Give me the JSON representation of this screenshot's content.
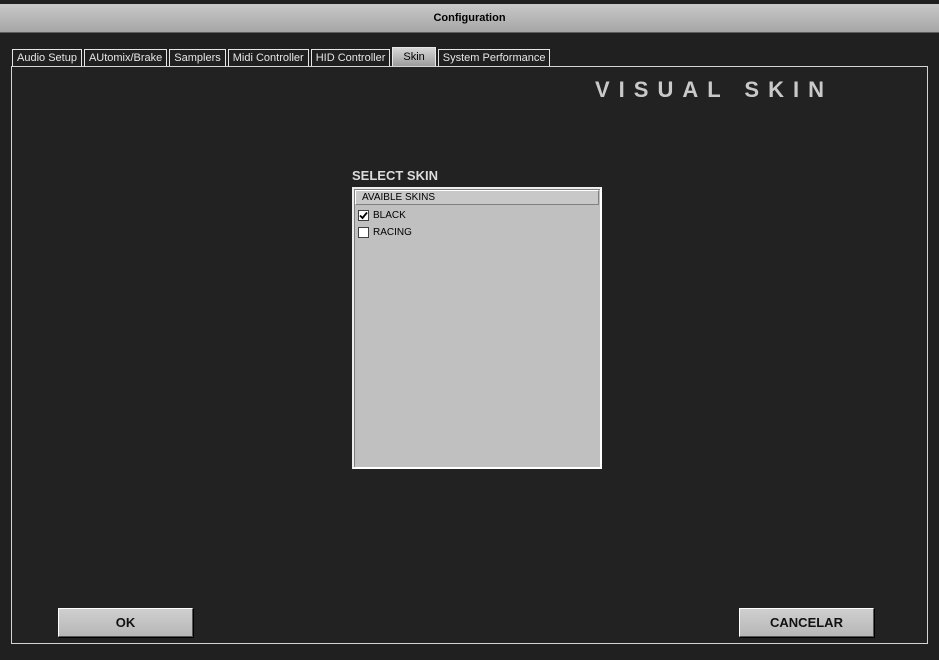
{
  "window": {
    "title": "Configuration"
  },
  "tabs": [
    {
      "label": "Audio Setup",
      "active": false
    },
    {
      "label": "AUtomix/Brake",
      "active": false
    },
    {
      "label": "Samplers",
      "active": false
    },
    {
      "label": "Midi Controller",
      "active": false
    },
    {
      "label": "HID Controller",
      "active": false
    },
    {
      "label": "Skin",
      "active": true
    },
    {
      "label": "System Performance",
      "active": false
    }
  ],
  "skin_page": {
    "heading": "VISUAL SKIN",
    "select_label": "SELECT SKIN",
    "list_header": "AVAIBLE SKINS",
    "skins": [
      {
        "label": "BLACK",
        "checked": true
      },
      {
        "label": "RACING",
        "checked": false
      }
    ]
  },
  "buttons": {
    "ok_label": "OK",
    "cancel_label": "CANCELAR"
  },
  "colors": {
    "background": "#202020",
    "panel_border": "#d4d4d4",
    "list_background": "#c0c0c0",
    "heading_text": "#c9c9c9"
  },
  "icons": {
    "checked_mark": "check-icon"
  }
}
